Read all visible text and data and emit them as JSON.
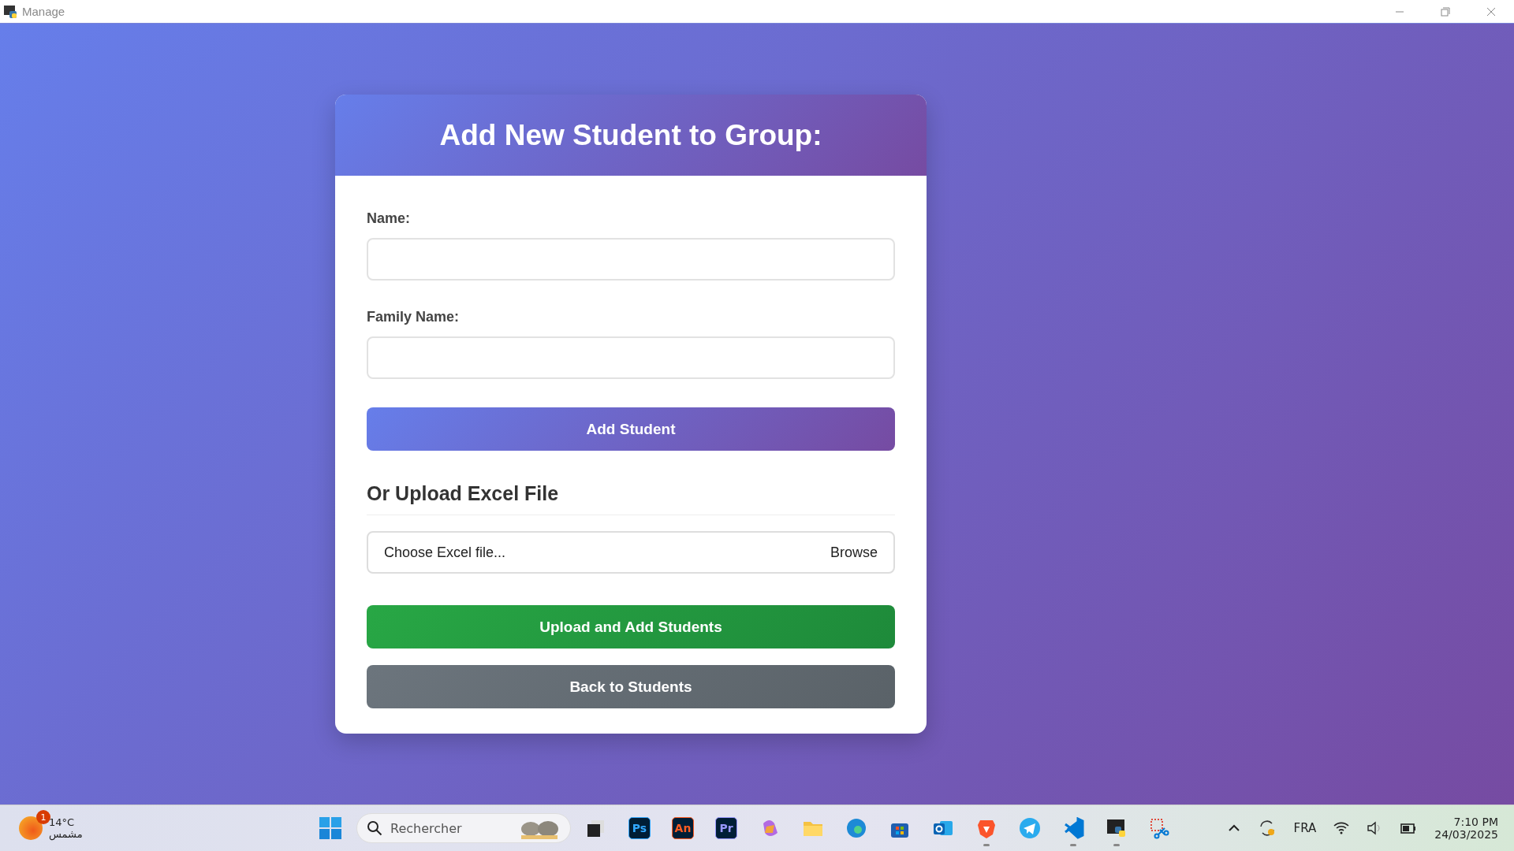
{
  "window": {
    "title": "Manage"
  },
  "form": {
    "title": "Add New Student to Group:",
    "fields": [
      {
        "label": "Name:"
      },
      {
        "label": "Family Name:"
      }
    ],
    "add_button": "Add Student",
    "upload_heading": "Or Upload Excel File",
    "file_input": {
      "placeholder": "Choose Excel file...",
      "browse": "Browse"
    },
    "upload_button": "Upload and Add Students",
    "back_button": "Back to Students"
  },
  "taskbar": {
    "weather": {
      "temp": "14°C",
      "condition": "مشمس",
      "badge": "1"
    },
    "search": {
      "placeholder": "Rechercher"
    },
    "apps": [
      {
        "kind": "taskview",
        "running": false
      },
      {
        "kind": "tile",
        "label": "Ps",
        "color": "#31a8ff",
        "running": false
      },
      {
        "kind": "tile",
        "label": "An",
        "color": "#ff5c22",
        "running": false
      },
      {
        "kind": "tile",
        "label": "Pr",
        "color": "#9999ff",
        "running": false
      },
      {
        "kind": "copilot",
        "running": false
      },
      {
        "kind": "folder",
        "running": false
      },
      {
        "kind": "edge",
        "running": false
      },
      {
        "kind": "store",
        "running": false
      },
      {
        "kind": "outlook",
        "running": false
      },
      {
        "kind": "brave",
        "running": true
      },
      {
        "kind": "telegram",
        "running": false
      },
      {
        "kind": "vscode",
        "running": true
      },
      {
        "kind": "python",
        "running": true
      },
      {
        "kind": "snip",
        "running": false
      }
    ],
    "language": "FRA",
    "time": "7:10 PM",
    "date": "24/03/2025"
  }
}
